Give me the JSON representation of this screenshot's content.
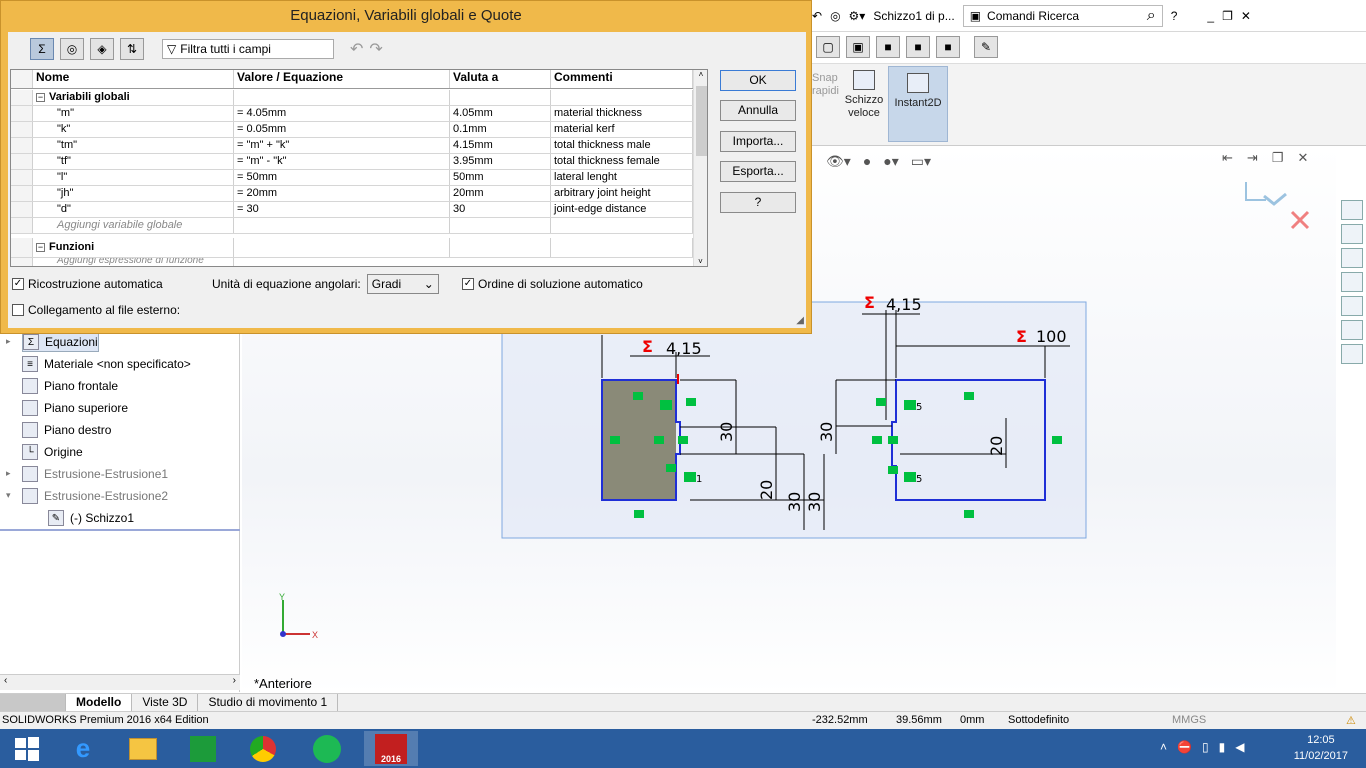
{
  "dialog": {
    "title": "Equazioni, Variabili globali e Quote",
    "filter_placeholder": "Filtra tutti i campi",
    "columns": [
      "Nome",
      "Valore / Equazione",
      "Valuta a",
      "Commenti"
    ],
    "group_globals": "Variabili globali",
    "variables": [
      {
        "name": "\"m\"",
        "value": "= 4.05mm",
        "evaluates": "4.05mm",
        "comment": "material thickness"
      },
      {
        "name": "\"k\"",
        "value": "= 0.05mm",
        "evaluates": "0.1mm",
        "comment": "material kerf"
      },
      {
        "name": "\"tm\"",
        "value": "= \"m\" + \"k\"",
        "evaluates": "4.15mm",
        "comment": "total thickness male"
      },
      {
        "name": "\"tf\"",
        "value": "= \"m\" - \"k\"",
        "evaluates": "3.95mm",
        "comment": "total thickness female"
      },
      {
        "name": "\"l\"",
        "value": "= 50mm",
        "evaluates": "50mm",
        "comment": "lateral lenght"
      },
      {
        "name": "\"jh\"",
        "value": "= 20mm",
        "evaluates": "20mm",
        "comment": "arbitrary joint height"
      },
      {
        "name": "\"d\"",
        "value": "= 30",
        "evaluates": "30",
        "comment": "joint-edge distance"
      }
    ],
    "add_global": "Aggiungi variabile globale",
    "group_functions": "Funzioni",
    "add_function": "Aggiungi espressione di funzione",
    "buttons": {
      "ok": "OK",
      "cancel": "Annulla",
      "import": "Importa...",
      "export": "Esporta...",
      "help": "?"
    },
    "opt_rebuild": "Ricostruzione automatica",
    "opt_angle_label": "Unità di equazione angolari:",
    "opt_angle_value": "Gradi",
    "opt_order": "Ordine di soluzione automatico",
    "opt_link": "Collegamento al file esterno:"
  },
  "top": {
    "doc_title": "Schizzo1 di p...",
    "search_label": "Comandi Ricerca",
    "help": "?"
  },
  "cmd": {
    "quick_snaps": "Snap\nrapidi",
    "schizzo": "Schizzo veloce",
    "instant2d": "Instant2D"
  },
  "tree": {
    "items": [
      {
        "label": "Equazioni",
        "dim": false
      },
      {
        "label": "Materiale <non specificato>",
        "dim": false
      },
      {
        "label": "Piano frontale",
        "dim": false
      },
      {
        "label": "Piano superiore",
        "dim": false
      },
      {
        "label": "Piano destro",
        "dim": false
      },
      {
        "label": "Origine",
        "dim": false
      },
      {
        "label": "Estrusione-Estrusione1",
        "dim": true
      },
      {
        "label": "Estrusione-Estrusione2",
        "dim": true
      },
      {
        "label": "(-) Schizzo1",
        "dim": false
      }
    ]
  },
  "view_label": "*Anteriore",
  "sketch_dims": {
    "d1": "4,15",
    "d2": "4,15",
    "d3": "100",
    "v30a": "30",
    "v30b": "30",
    "v20a": "20",
    "v20b": "20",
    "v30c": "30",
    "v30d": "30",
    "s1": "1",
    "s5a": "5",
    "s5b": "5"
  },
  "axes": {
    "y": "Y",
    "x": "X"
  },
  "tabs": [
    "",
    "Modello",
    "Viste 3D",
    "Studio di movimento 1"
  ],
  "status": {
    "product": "SOLIDWORKS Premium 2016 x64 Edition",
    "x": "-232.52mm",
    "y": "39.56mm",
    "z": "0mm",
    "state": "Sottodefinito",
    "units": "MMGS"
  },
  "clock": {
    "time": "12:05",
    "date": "11/02/2017"
  },
  "taskbar_sw": "2016",
  "colors": {
    "dialog": "#f0b94a",
    "taskbar": "#2a5d9e",
    "sketch": "#1f2fd6",
    "dim": "#e00000"
  }
}
